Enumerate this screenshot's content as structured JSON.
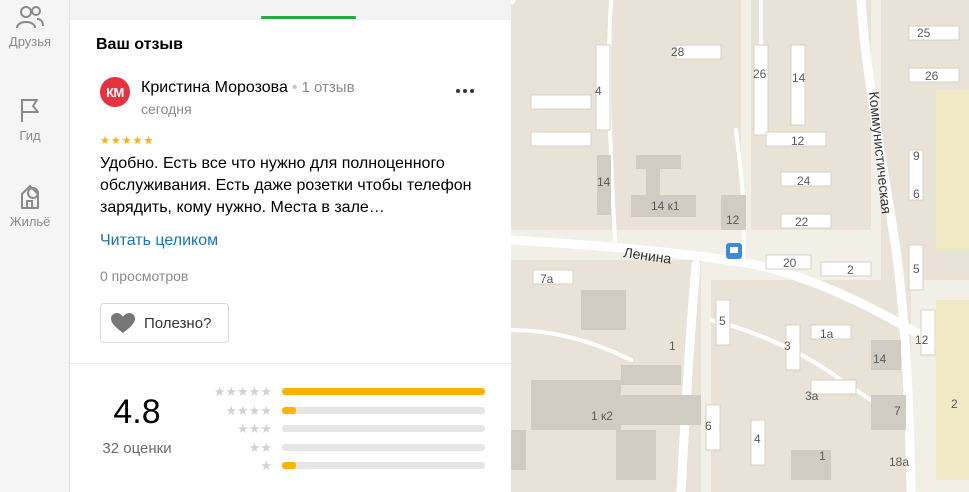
{
  "sidebar": {
    "items": [
      {
        "label": "Друзья",
        "icon": "friends-icon"
      },
      {
        "label": "Гид",
        "icon": "flag-icon"
      },
      {
        "label": "Жильё",
        "icon": "house-icon"
      }
    ]
  },
  "review": {
    "section_title": "Ваш отзыв",
    "avatar_initials": "КМ",
    "author_name": "Кристина Морозова",
    "review_count": "1 отзыв",
    "date": "сегодня",
    "stars": 5,
    "text": "Удобно. Есть все что нужно для полноценного обслуживания. Есть даже розетки чтобы телефон зарядить, кому нужно. Места в зале…",
    "read_more": "Читать целиком",
    "views": "0 просмотров",
    "useful_label": "Полезно?"
  },
  "rating": {
    "value": "4.8",
    "count_label": "32 оценки",
    "distribution": [
      {
        "stars": "★★★★★",
        "fraction": 1.0
      },
      {
        "stars": "★★★★",
        "fraction": 0.07
      },
      {
        "stars": "★★★",
        "fraction": 0.0
      },
      {
        "stars": "★★",
        "fraction": 0.0
      },
      {
        "stars": "★",
        "fraction": 0.07
      }
    ]
  },
  "map": {
    "streets": [
      "Ленина",
      "Коммунистическая"
    ],
    "buildings": [
      "28",
      "26",
      "14",
      "25",
      "26",
      "4",
      "12",
      "24",
      "9",
      "14",
      "14 к1",
      "12",
      "22",
      "6",
      "20",
      "2",
      "5",
      "7а",
      "5",
      "1а",
      "3",
      "12",
      "14",
      "1",
      "3а",
      "7",
      "1 к2",
      "6",
      "4",
      "1",
      "18а",
      "2"
    ]
  },
  "colors": {
    "accent_green": "#2ba93f",
    "star_yellow": "#fcb200",
    "link_blue": "#1a73b8",
    "avatar_red": "#e8313f",
    "map_background": "#f2efe6"
  }
}
